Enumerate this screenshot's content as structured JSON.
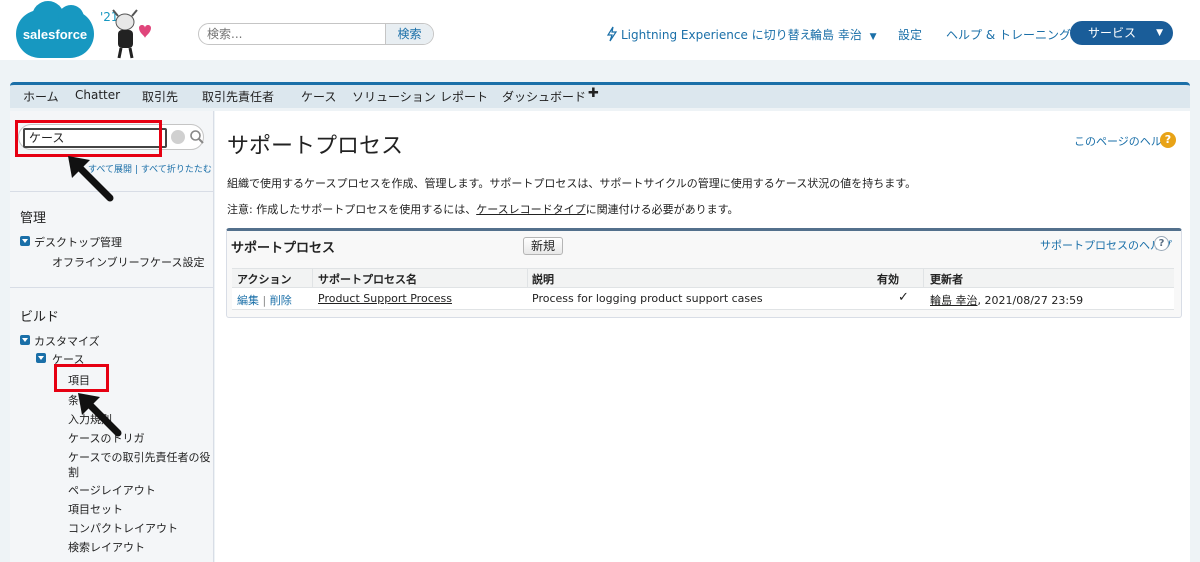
{
  "header": {
    "logo_text": "salesforce",
    "release": "'21",
    "search_placeholder": "検索...",
    "search_button": "検索",
    "lightning_link": "Lightning Experience に切り替え",
    "user_name": "輪島 幸治",
    "settings_link": "設定",
    "help_link": "ヘルプ & トレーニング",
    "app_switcher": "サービス"
  },
  "tabs": [
    "ホーム",
    "Chatter",
    "取引先",
    "取引先責任者",
    "ケース",
    "ソリューション",
    "レポート",
    "ダッシュボード"
  ],
  "sidebar": {
    "search_value": "ケース",
    "expand_all": "すべて展開",
    "collapse_all": "すべて折りたたむ",
    "link_separator": "|",
    "section_admin": "管理",
    "desktop_admin": "デスクトップ管理",
    "offline_briefcase": "オフラインブリーフケース設定",
    "section_build": "ビルド",
    "customize": "カスタマイズ",
    "case": "ケース",
    "items": [
      "項目",
      "条",
      "入力規則",
      "ケースのトリガ",
      "ケースでの取引先責任者の役",
      "割",
      "ページレイアウト",
      "項目セット",
      "コンパクトレイアウト",
      "検索レイアウト"
    ]
  },
  "main": {
    "title": "サポートプロセス",
    "page_help": "このページのヘルプ",
    "desc1": "組織で使用するケースプロセスを作成、管理します。サポートプロセスは、サポートサイクルの管理に使用するケース状況の値を持ちます。",
    "desc2_prefix": "注意: 作成したサポートプロセスを使用するには、",
    "desc2_link": "ケースレコードタイプ",
    "desc2_suffix": "に関連付ける必要があります。"
  },
  "panel": {
    "title": "サポートプロセス",
    "new_button": "新規",
    "help": "サポートプロセスのヘルプ",
    "columns": [
      "アクション",
      "サポートプロセス名",
      "説明",
      "有効",
      "更新者"
    ],
    "rows": [
      {
        "edit": "編集",
        "separator": "|",
        "delete": "削除",
        "name": "Product Support Process",
        "description": "Process for logging product support cases",
        "active": "✓",
        "updated_by": "輪島 幸治",
        "updated_at": ", 2021/08/27 23:59"
      }
    ]
  },
  "colors": {
    "accent": "#1a6fa8",
    "highlight_red": "#e60012",
    "brand_blue": "#1798c1",
    "service_button": "#1a5d99"
  }
}
